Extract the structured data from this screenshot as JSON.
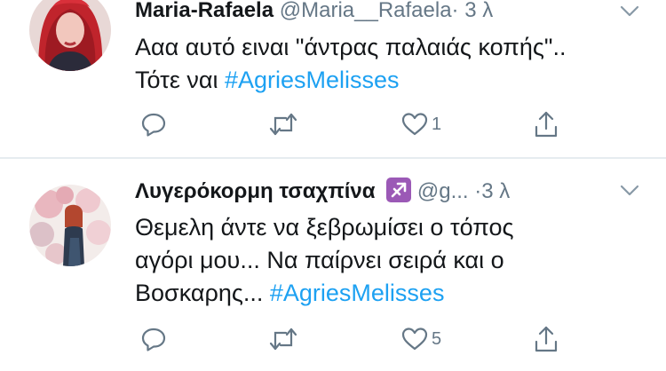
{
  "colors": {
    "accent": "#1da1f2",
    "secondary_text": "#657786",
    "primary_text": "#14171a",
    "divider": "#e6ecf0",
    "emoji_bg": "#9b59b6"
  },
  "tweets": [
    {
      "name": "Maria-Rafaela",
      "handle": "@Maria__Rafaela",
      "separator": "·",
      "time": "3 λ",
      "text_line1": "Ααα αυτό ειναι \"άντρας παλαιάς κοπής\"..",
      "text_line2_prefix": "Τότε ναι ",
      "hashtag": "#AgriesMelisses",
      "like_count": "1",
      "icons": [
        "reply-icon",
        "retweet-icon",
        "heart-icon",
        "share-icon",
        "chevron-down-icon"
      ]
    },
    {
      "name": "Λυγερόκορμη τσαχπίνα",
      "name_emoji": "sagittarius-emoji",
      "handle": "@g...",
      "separator": "·",
      "time": "3 λ",
      "text_line1": "Θεμελη άντε να ξεβρωμίσει ο τόπος",
      "text_line2": "αγόρι μου... Να παίρνει σειρά και ο",
      "text_line3_prefix": "Βοσκαρης... ",
      "hashtag": "#AgriesMelisses",
      "like_count": "5",
      "icons": [
        "reply-icon",
        "retweet-icon",
        "heart-icon",
        "share-icon",
        "chevron-down-icon"
      ]
    }
  ]
}
